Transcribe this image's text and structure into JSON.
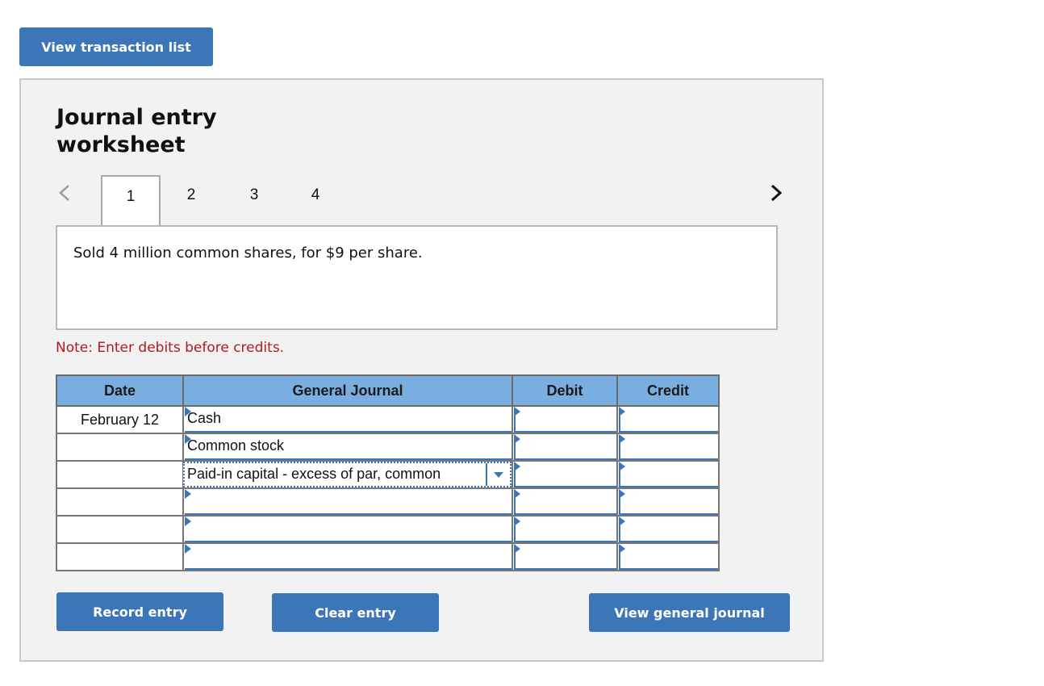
{
  "toolbar": {
    "view_transaction_list_label": "View transaction list"
  },
  "worksheet": {
    "title": "Journal entry worksheet",
    "nav": {
      "prev_icon": "chevron-left-icon",
      "next_icon": "chevron-right-icon"
    },
    "tabs": [
      {
        "label": "1",
        "active": true
      },
      {
        "label": "2",
        "active": false
      },
      {
        "label": "3",
        "active": false
      },
      {
        "label": "4",
        "active": false
      }
    ],
    "description": "Sold 4 million common shares, for $9 per share.",
    "note": "Note: Enter debits before credits.",
    "table": {
      "headers": {
        "date": "Date",
        "general_journal": "General Journal",
        "debit": "Debit",
        "credit": "Credit"
      },
      "rows": [
        {
          "date": "February 12",
          "account": "Cash",
          "debit": "",
          "credit": ""
        },
        {
          "date": "",
          "account": "Common stock",
          "debit": "",
          "credit": ""
        },
        {
          "date": "",
          "account": "Paid-in capital - excess of par, common",
          "debit": "",
          "credit": "",
          "has_dropdown": true,
          "focused": true
        },
        {
          "date": "",
          "account": "",
          "debit": "",
          "credit": ""
        },
        {
          "date": "",
          "account": "",
          "debit": "",
          "credit": ""
        },
        {
          "date": "",
          "account": "",
          "debit": "",
          "credit": ""
        }
      ]
    },
    "buttons": {
      "record_entry": "Record entry",
      "clear_entry": "Clear entry",
      "view_general_journal": "View general journal"
    }
  },
  "colors": {
    "button_blue": "#3d76b8",
    "header_blue": "#7aaee0",
    "note_red": "#b0191e",
    "panel_bg": "#f2f2f2"
  }
}
